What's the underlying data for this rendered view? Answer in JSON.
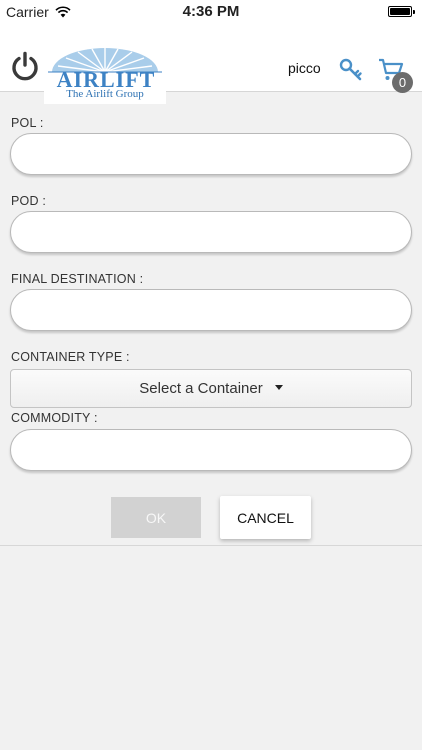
{
  "status": {
    "carrier": "Carrier",
    "time": "4:36 PM"
  },
  "header": {
    "logo_title": "AIRLIFT",
    "logo_subtitle": "The Airlift Group",
    "username": "picco",
    "cart_count": "0",
    "accent_color": "#4a90c8"
  },
  "form": {
    "pol_label": "POL :",
    "pod_label": "POD :",
    "final_destination_label": "FINAL DESTINATION :",
    "container_type_label": "CONTAINER TYPE :",
    "container_select_value": "Select a Container",
    "commodity_label": "COMMODITY :"
  },
  "actions": {
    "ok_label": "OK",
    "cancel_label": "CANCEL"
  }
}
